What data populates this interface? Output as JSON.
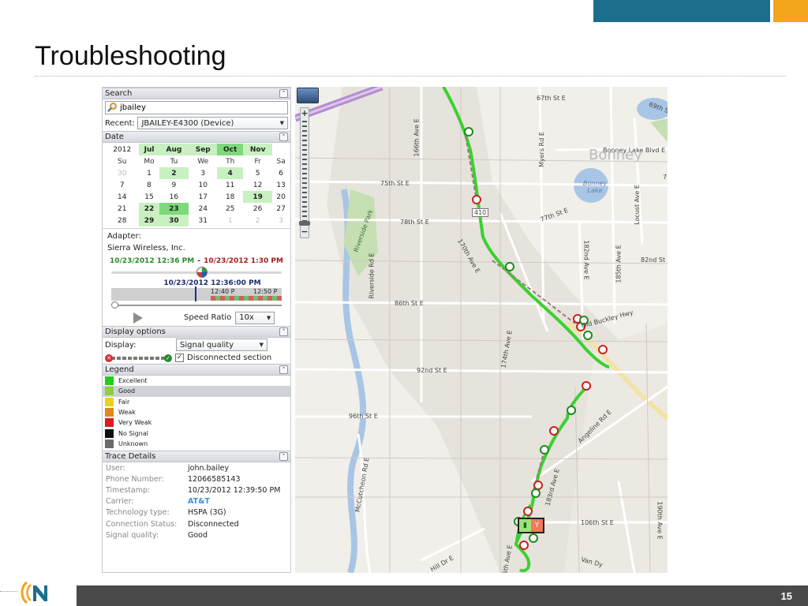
{
  "slide": {
    "title": "Troubleshooting",
    "number": "15"
  },
  "colors": {
    "brand_blue": "#1c6e8c",
    "brand_orange": "#f3a51c",
    "route_green": "#44d13a",
    "footer": "#4a4a4a"
  },
  "search": {
    "header": "Search",
    "query": "jbailey",
    "recent_label": "Recent:",
    "recent_value": "JBAILEY-E4300 (Device)"
  },
  "date": {
    "header": "Date",
    "year": "2012",
    "months": [
      "Jul",
      "Aug",
      "Sep",
      "Oct",
      "Nov"
    ],
    "weekdays": [
      "Su",
      "Mo",
      "Tu",
      "We",
      "Th",
      "Fr",
      "Sa"
    ],
    "weeks": [
      [
        "30",
        "1",
        "2",
        "3",
        "4",
        "5",
        "6"
      ],
      [
        "7",
        "8",
        "9",
        "10",
        "11",
        "12",
        "13"
      ],
      [
        "14",
        "15",
        "16",
        "17",
        "18",
        "19",
        "20"
      ],
      [
        "21",
        "22",
        "23",
        "24",
        "25",
        "26",
        "27"
      ],
      [
        "28",
        "29",
        "30",
        "31",
        "1",
        "2",
        "3"
      ]
    ]
  },
  "adapter": {
    "label": "Adapter:",
    "name": "Sierra Wireless, Inc.",
    "start_time": "10/23/2012 12:36 PM",
    "separator": "-",
    "end_time": "10/23/2012 1:30 PM",
    "cursor_time": "10/23/2012 12:36:00 PM",
    "tick1": "12:40 P",
    "tick2": "12:50 P",
    "speed_label": "Speed Ratio",
    "speed_value": "10x"
  },
  "display": {
    "header": "Display options",
    "label": "Display:",
    "value": "Signal quality",
    "checkbox_label": "Disconnected section",
    "checked": "✓"
  },
  "legend": {
    "header": "Legend",
    "items": [
      {
        "label": "Excellent",
        "color": "#22cc22"
      },
      {
        "label": "Good",
        "color": "#8fcf3a"
      },
      {
        "label": "Fair",
        "color": "#e8d21a"
      },
      {
        "label": "Weak",
        "color": "#e08a1a"
      },
      {
        "label": "Very Weak",
        "color": "#d81e1e"
      },
      {
        "label": "No Signal",
        "color": "#111111"
      },
      {
        "label": "Unknown",
        "color": "#6a6a6a"
      }
    ]
  },
  "trace": {
    "header": "Trace Details",
    "rows": [
      {
        "k": "User:",
        "v": "john.bailey"
      },
      {
        "k": "Phone Number:",
        "v": "12066585143"
      },
      {
        "k": "Timestamp:",
        "v": "10/23/2012 12:39:50 PM"
      },
      {
        "k": "Carrier:",
        "v": "AT&T"
      },
      {
        "k": "Technology type:",
        "v": "HSPA (3G)"
      },
      {
        "k": "Connection Status:",
        "v": "Disconnected"
      },
      {
        "k": "Signal quality:",
        "v": "Good"
      }
    ]
  },
  "map": {
    "labels": [
      "67th St E",
      "69th S",
      "Bonney Lake Blvd E",
      "Bonney",
      "Bonney Lake",
      "166th Ave E",
      "Myers Rd E",
      "75th St E",
      "410",
      "77th St E",
      "Locust Ave E",
      "78th St E",
      "Riverside Park",
      "170th Ave E",
      "182nd Ave E",
      "185th Ave E",
      "82nd St",
      "Riverside Rd E",
      "86th St E",
      "Old Buckley Hwy",
      "174th Ave E",
      "92nd St E",
      "96th St E",
      "Angeline Rd E",
      "McCutcheon Rd E",
      "183rd Ave E",
      "106th St E",
      "Hill Dr E",
      "5th Ave E",
      "Van Dy",
      "190th Ave E",
      "7"
    ]
  }
}
